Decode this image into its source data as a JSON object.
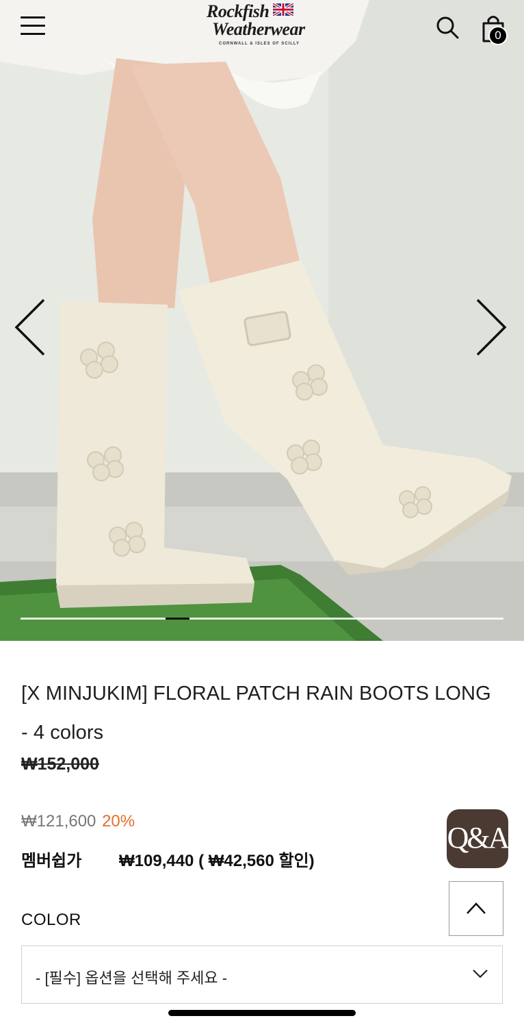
{
  "header": {
    "logo_line1": "Rockfish",
    "logo_line2": "Weatherwear",
    "logo_tagline": "CORNWALL & ISLES OF SCILLY",
    "cart_count": "0",
    "icons": [
      "menu-icon",
      "search-icon",
      "shopping-bag-icon"
    ]
  },
  "gallery": {
    "progress_fraction_start": 0.3,
    "progress_fraction_width": 0.05,
    "icons": [
      "chevron-left-icon",
      "chevron-right-icon"
    ]
  },
  "product": {
    "title": "[X MINJUKIM] FLORAL PATCH RAIN BOOTS LONG - 4 colors",
    "original_price": "₩152,000",
    "sale_price": "₩121,600",
    "discount": "20%",
    "member_label": "멤버쉽가",
    "member_price": "₩109,440 ( ₩42,560 할인)"
  },
  "floating": {
    "qa_label": "Q&A",
    "top_icon": "chevron-up-icon"
  },
  "options": {
    "color_label": "COLOR",
    "select_value": "- [필수] 옵션을 선택해 주세요 -",
    "select_icon": "chevron-down-icon"
  },
  "colors": {
    "discount": "#e2702b",
    "qa_bg": "#4a3a31",
    "boot": "#efe9da"
  }
}
